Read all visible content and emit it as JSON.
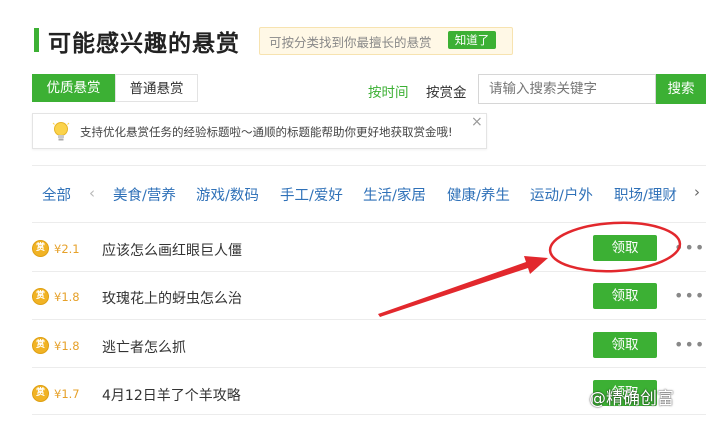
{
  "header": {
    "title": "可能感兴趣的悬赏",
    "tip_text": "可按分类找到你最擅长的悬赏",
    "tip_button": "知道了"
  },
  "tabs": [
    {
      "label": "优质悬赏",
      "active": true
    },
    {
      "label": "普通悬赏",
      "active": false
    }
  ],
  "sort": {
    "by_time": "按时间",
    "by_bounty": "按赏金"
  },
  "search": {
    "placeholder": "请输入搜索关键字",
    "button": "搜索"
  },
  "notice": {
    "text": "支持优化悬赏任务的经验标题啦～通顺的标题能帮助你更好地获取赏金哦!",
    "close": "×"
  },
  "categories": {
    "items": [
      "全部",
      "美食/营养",
      "游戏/数码",
      "手工/爱好",
      "生活/家居",
      "健康/养生",
      "运动/户外",
      "职场/理财"
    ],
    "prev": "‹",
    "more": "›"
  },
  "rows": [
    {
      "coin": "赏",
      "amount": "¥2.1",
      "title": "应该怎么画红眼巨人僵",
      "action": "领取",
      "more": "•••"
    },
    {
      "coin": "赏",
      "amount": "¥1.8",
      "title": "玫瑰花上的蚜虫怎么治",
      "action": "领取",
      "more": "•••"
    },
    {
      "coin": "赏",
      "amount": "¥1.8",
      "title": "逃亡者怎么抓",
      "action": "领取",
      "more": "•••"
    },
    {
      "coin": "赏",
      "amount": "¥1.7",
      "title": "4月12日羊了个羊攻略",
      "action": "领取",
      "more": "•••"
    }
  ],
  "watermark": "@精确创富",
  "colors": {
    "accent": "#3cb034",
    "annotation": "#e2282d",
    "link": "#2f71b8",
    "coin": "#f1b325"
  }
}
